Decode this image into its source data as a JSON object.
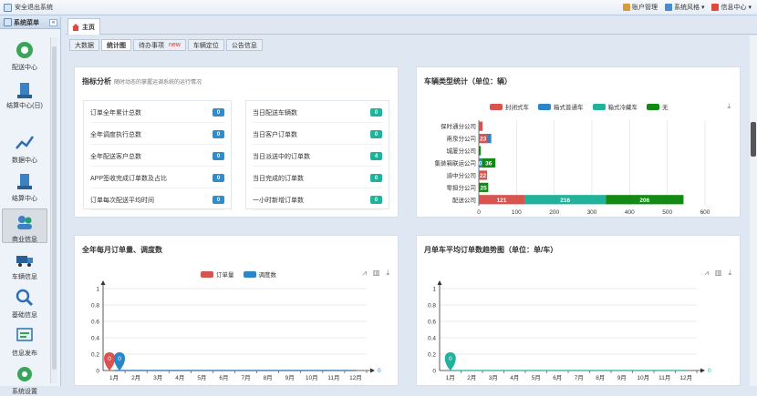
{
  "topbar": {
    "exit_label": "安全退出系统",
    "account_label": "账户管理",
    "style_label": "系统风格",
    "info_label": "信息中心"
  },
  "sidebar": {
    "title": "系统菜单",
    "collapse_glyph": "«",
    "items": [
      {
        "label": "配送中心",
        "icon": "delivery-center-icon"
      },
      {
        "label": "结算中心(日)",
        "icon": "settlement-day-icon"
      },
      {
        "label": "数据中心",
        "icon": "data-center-icon"
      },
      {
        "label": "结算中心",
        "icon": "settlement-icon"
      },
      {
        "label": "商业信息",
        "icon": "business-info-icon"
      },
      {
        "label": "车辆信息",
        "icon": "vehicle-info-icon"
      },
      {
        "label": "基础信息",
        "icon": "basic-info-icon"
      },
      {
        "label": "信息发布",
        "icon": "info-publish-icon"
      },
      {
        "label": "系统设置",
        "icon": "system-settings-icon"
      }
    ]
  },
  "tabs": {
    "home": "主页"
  },
  "subtabs": {
    "items": [
      "大数据",
      "统计图",
      "待办事项",
      "车辆定位",
      "公告信息"
    ],
    "active": "统计图",
    "new_badge": "new"
  },
  "indicators": {
    "title": "指标分析",
    "subtitle": "随时动态的掌握运调系统的运行情况",
    "left": [
      {
        "label": "订单全年累计总数",
        "value": "0",
        "color": "#2a8fd0"
      },
      {
        "label": "全年调度执行总数",
        "value": "0",
        "color": "#2a8fd0"
      },
      {
        "label": "全年配送客户总数",
        "value": "0",
        "color": "#2a8fd0"
      },
      {
        "label": "APP签收完成订单数及占比",
        "value": "0",
        "color": "#2a8fd0"
      },
      {
        "label": "订单每次配送平均时间",
        "value": "0",
        "color": "#2a8fd0"
      }
    ],
    "right": [
      {
        "label": "当日配送车辆数",
        "value": "0",
        "color": "#20b29a"
      },
      {
        "label": "当日客户订单数",
        "value": "0",
        "color": "#20b29a"
      },
      {
        "label": "当日派送中的订单数",
        "value": "4",
        "color": "#20b29a"
      },
      {
        "label": "当日完成的订单数",
        "value": "0",
        "color": "#20b29a"
      },
      {
        "label": "一小时新增订单数",
        "value": "0",
        "color": "#20b29a"
      }
    ]
  },
  "vehicle_chart": {
    "title": "车辆类型统计（单位：辆）",
    "chart_data": {
      "type": "bar",
      "orientation": "horizontal",
      "stacked": true,
      "categories": [
        "保时通分公司",
        "南泉分公司",
        "城厦分公司",
        "集装箱联运公司",
        "渝中分公司",
        "零担分公司",
        "配送公司"
      ],
      "series": [
        {
          "name": "封闭式车",
          "color": "#d9534f",
          "values": [
            10,
            23,
            0,
            0,
            22,
            0,
            121
          ]
        },
        {
          "name": "箱式普通车",
          "color": "#2a86c8",
          "values": [
            0,
            10,
            0,
            8,
            0,
            0,
            0
          ]
        },
        {
          "name": "箱式冷藏车",
          "color": "#20b29a",
          "values": [
            0,
            0,
            0,
            0,
            0,
            0,
            216
          ]
        },
        {
          "name": "无",
          "color": "#138a13",
          "values": [
            0,
            0,
            5,
            36,
            0,
            25,
            206
          ]
        }
      ],
      "xlim": [
        0,
        600
      ],
      "xticks": [
        "0",
        "100",
        "200",
        "300",
        "400",
        "500",
        "600"
      ],
      "labels": [
        {
          "cat": 0,
          "series": 0,
          "text": ""
        },
        {
          "cat": 1,
          "series": 0,
          "text": "23"
        },
        {
          "cat": 3,
          "series": 1,
          "text": "0"
        },
        {
          "cat": 3,
          "series": 3,
          "text": "36"
        },
        {
          "cat": 4,
          "series": 0,
          "text": "22"
        },
        {
          "cat": 5,
          "series": 3,
          "text": "25"
        },
        {
          "cat": 6,
          "series": 0,
          "text": "121"
        },
        {
          "cat": 6,
          "series": 2,
          "text": "216"
        },
        {
          "cat": 6,
          "series": 3,
          "text": "206"
        }
      ]
    }
  },
  "orders_chart": {
    "title": "全年每月订单量、调度数",
    "chart_data": {
      "type": "line",
      "categories": [
        "1月",
        "2月",
        "3月",
        "4月",
        "5月",
        "6月",
        "7月",
        "8月",
        "9月",
        "10月",
        "11月",
        "12月"
      ],
      "series": [
        {
          "name": "订单量",
          "color": "#d9534f",
          "values": [
            0,
            0,
            0,
            0,
            0,
            0,
            0,
            0,
            0,
            0,
            0,
            0
          ]
        },
        {
          "name": "调度数",
          "color": "#2a86c8",
          "values": [
            0,
            0,
            0,
            0,
            0,
            0,
            0,
            0,
            0,
            0,
            0,
            0
          ]
        }
      ],
      "ylim": [
        0,
        1
      ],
      "yticks": [
        "1",
        "0.8",
        "0.6",
        "0.4",
        "0.2",
        "0"
      ],
      "pins": [
        {
          "series": 0,
          "text": "0"
        },
        {
          "series": 1,
          "text": "0"
        }
      ],
      "end_label": "0"
    }
  },
  "avg_chart": {
    "title": "月单车平均订单数趋势图（单位：单/车）",
    "chart_data": {
      "type": "line",
      "categories": [
        "1月",
        "2月",
        "3月",
        "4月",
        "5月",
        "6月",
        "7月",
        "8月",
        "9月",
        "10月",
        "11月",
        "12月"
      ],
      "series": [
        {
          "color": "#20b29a",
          "values": [
            0,
            0,
            0,
            0,
            0,
            0,
            0,
            0,
            0,
            0,
            0,
            0
          ]
        }
      ],
      "ylim": [
        0,
        1
      ],
      "yticks": [
        "1",
        "0.8",
        "0.6",
        "0.4",
        "0.2",
        "0"
      ],
      "pins": [
        {
          "series": 0,
          "text": "0"
        }
      ],
      "end_label": "0"
    }
  }
}
